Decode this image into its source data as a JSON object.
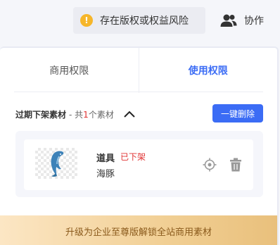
{
  "header": {
    "risk_label": "存在版权或权益风险",
    "warn_glyph": "!",
    "collab_label": "协作"
  },
  "tabs": [
    {
      "label": "商用权限",
      "active": false
    },
    {
      "label": "使用权限",
      "active": true
    }
  ],
  "section": {
    "title": "过期下架素材",
    "count_prefix": "- 共",
    "count": "1",
    "count_suffix": "个素材",
    "delete_all_label": "一键删除"
  },
  "items": [
    {
      "type": "道具",
      "status": "已下架",
      "name": "海豚",
      "thumbnail": "dolphin-illustration"
    }
  ],
  "upgrade": {
    "label": "升级为企业至尊版解锁全站商用素材"
  },
  "colors": {
    "accent": "#3b6cf5",
    "warning": "#f6b62a",
    "danger": "#e03232",
    "upgrade_text": "#8a5a1c"
  },
  "icons": [
    "warning-icon",
    "collaborate-users-icon",
    "chevron-up-icon",
    "locate-icon",
    "trash-icon"
  ]
}
